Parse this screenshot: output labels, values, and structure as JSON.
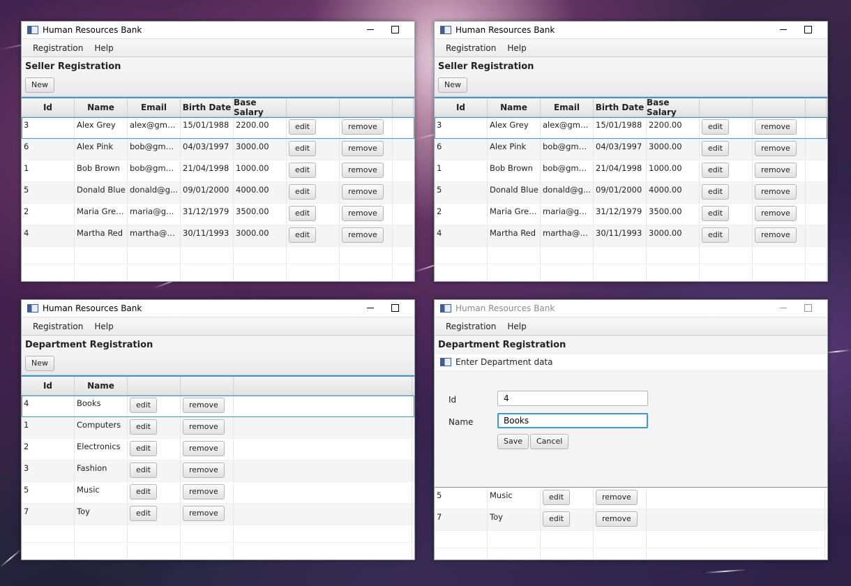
{
  "app_title": "Human Resources Bank",
  "menu": [
    "Registration",
    "Help"
  ],
  "new_label": "New",
  "edit_label": "edit",
  "remove_label": "remove",
  "seller": {
    "title": "Seller Registration",
    "columns": [
      "Id",
      "Name",
      "Email",
      "Birth Date",
      "Base Salary",
      "",
      ""
    ],
    "rows": [
      {
        "id": "3",
        "name": "Alex Grey",
        "email": "alex@gmai...",
        "birth": "15/01/1988",
        "salary": "2200.00"
      },
      {
        "id": "6",
        "name": "Alex Pink",
        "email": "bob@gmai...",
        "birth": "04/03/1997",
        "salary": "3000.00"
      },
      {
        "id": "1",
        "name": "Bob Brown",
        "email": "bob@gmai...",
        "birth": "21/04/1998",
        "salary": "1000.00"
      },
      {
        "id": "5",
        "name": "Donald Blue",
        "email": "donald@g...",
        "birth": "09/01/2000",
        "salary": "4000.00"
      },
      {
        "id": "2",
        "name": "Maria Green",
        "email": "maria@gm...",
        "birth": "31/12/1979",
        "salary": "3500.00"
      },
      {
        "id": "4",
        "name": "Martha Red",
        "email": "martha@g...",
        "birth": "30/11/1993",
        "salary": "3000.00"
      }
    ]
  },
  "department": {
    "title": "Department Registration",
    "columns": [
      "Id",
      "Name",
      "",
      ""
    ],
    "rows": [
      {
        "id": "4",
        "name": "Books"
      },
      {
        "id": "1",
        "name": "Computers"
      },
      {
        "id": "2",
        "name": "Electronics"
      },
      {
        "id": "3",
        "name": "Fashion"
      },
      {
        "id": "5",
        "name": "Music"
      },
      {
        "id": "7",
        "name": "Toy"
      }
    ]
  },
  "dialog": {
    "title": "Enter Department data",
    "id_label": "Id",
    "name_label": "Name",
    "id_value": "4",
    "name_value": "Books",
    "save_label": "Save",
    "cancel_label": "Cancel",
    "rows_visible": [
      {
        "id": "5",
        "name": "Music"
      },
      {
        "id": "7",
        "name": "Toy"
      }
    ]
  },
  "colors": {
    "accent": "#3a9ad9",
    "window_bg": "#f4f4f4"
  },
  "icons": [
    "app-window-icon",
    "minimize-icon",
    "maximize-icon"
  ]
}
